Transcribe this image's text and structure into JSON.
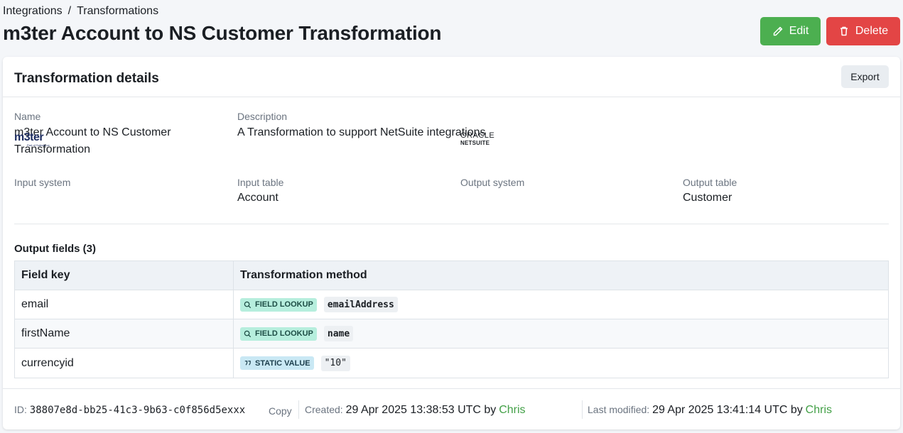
{
  "breadcrumb": {
    "parent": "Integrations",
    "separator": "/",
    "current": "Transformations"
  },
  "page": {
    "title": "m3ter Account to NS Customer Transformation"
  },
  "actions": {
    "edit_label": "Edit",
    "delete_label": "Delete"
  },
  "card": {
    "title": "Transformation details",
    "export_label": "Export",
    "name_label": "Name",
    "name_value_line1": "m3ter Account to NS Customer",
    "name_value_line2": "Transformation",
    "description_label": "Description",
    "description_value": "A Transformation to support NetSuite integrations",
    "input_system_label": "Input system",
    "input_system_logo": {
      "word": "m3ter",
      "sub": "Part of Salesforce"
    },
    "input_table_label": "Input table",
    "input_table_value": "Account",
    "output_system_label": "Output system",
    "output_system_logo": {
      "line1": "ORACLE",
      "line2": "NETSUITE"
    },
    "output_table_label": "Output table",
    "output_table_value": "Customer"
  },
  "output_fields": {
    "title": "Output fields (3)",
    "headers": {
      "key": "Field key",
      "method": "Transformation method"
    },
    "rows": [
      {
        "key": "email",
        "tag": "FIELD LOOKUP",
        "tag_icon": "search-icon",
        "value": "emailAddress"
      },
      {
        "key": "firstName",
        "tag": "FIELD LOOKUP",
        "tag_icon": "search-icon",
        "value": "name"
      },
      {
        "key": "currencyid",
        "tag": "STATIC VALUE",
        "tag_icon": "quote-icon",
        "value": "\"10\""
      }
    ]
  },
  "footer": {
    "id_label": "ID:",
    "id_value": "38807e8d-bb25-41c3-9b63-c0f856d5exxx",
    "copy_label": "Copy",
    "created_label": "Created:",
    "created_value": "29 Apr 2025 13:38:53 UTC by",
    "created_by": "Chris",
    "modified_label": "Last modified:",
    "modified_value": "29 Apr 2025 13:41:14 UTC by",
    "modified_by": "Chris"
  },
  "colors": {
    "edit": "#4caf50",
    "delete": "#e34545",
    "lookup_tag": "#b6eedd",
    "static_tag": "#c9e8f4",
    "user_link": "#43a047"
  }
}
